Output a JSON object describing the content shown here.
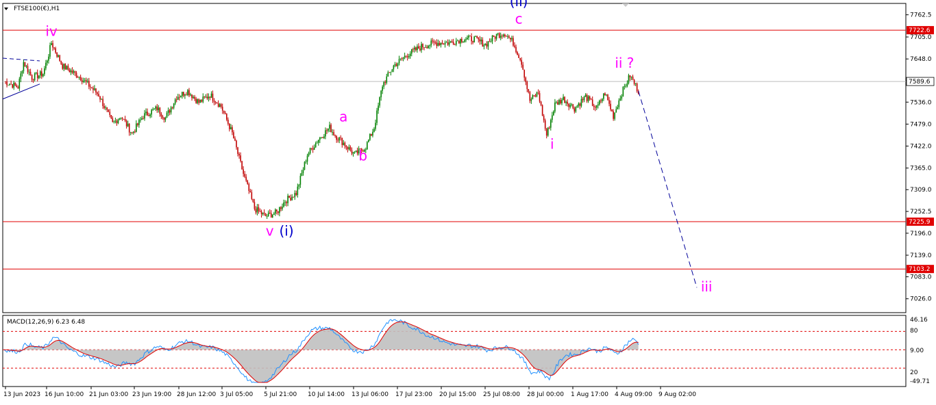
{
  "header": {
    "symbol_label": "FTSE100(€),H1",
    "dropdown_icon": "triangle-down-icon"
  },
  "colors": {
    "background": "#ffffff",
    "border": "#000000",
    "bull_candle": "#008000",
    "bear_candle": "#c00000",
    "level_line": "#e00000",
    "current_price_line": "#bcbcbc",
    "wave_pink": "#ff00ff",
    "wave_blue": "#0000cc",
    "projection_line": "#000099",
    "macd_hist": "#c0c0c0",
    "macd_main": "#1e90ff",
    "macd_signal": "#e00000",
    "macd_levels": "#e00000"
  },
  "chart_data": [
    {
      "type": "candlestick",
      "title": "FTSE100(€),H1",
      "ylim": [
        6990,
        7792
      ],
      "y_ticks": [
        7762.5,
        7705.0,
        7648.0,
        7592.5,
        7536.0,
        7479.0,
        7422.0,
        7365.0,
        7309.0,
        7252.5,
        7196.0,
        7139.0,
        7083.0,
        7026.0
      ],
      "y_tick_labels": [
        "7762.5",
        "7705.0",
        "7648.0",
        "7592.5",
        "7536.0",
        "7479.0",
        "7422.0",
        "7365.0",
        "7309.0",
        "7252.5",
        "7196.0",
        "7139.0",
        "7083.0",
        "7026.0"
      ],
      "x_tick_labels": [
        "13 Jun 2023",
        "16 Jun 10:00",
        "21 Jun 03:00",
        "23 Jun 19:00",
        "28 Jun 12:00",
        "3 Jul 05:00",
        "5 Jul 21:00",
        "10 Jul 14:00",
        "13 Jul 06:00",
        "17 Jul 23:00",
        "20 Jul 15:00",
        "25 Jul 08:00",
        "28 Jul 00:00",
        "1 Aug 17:00",
        "4 Aug 09:00",
        "9 Aug 02:00"
      ],
      "levels": [
        {
          "value": 7722.6,
          "label": "7722.6"
        },
        {
          "value": 7225.9,
          "label": "7225.9"
        },
        {
          "value": 7103.2,
          "label": "7103.2"
        }
      ],
      "current_price": {
        "value": 7589.6,
        "label": "7589.6"
      },
      "price_path": [
        [
          0,
          7590
        ],
        [
          10,
          7575
        ],
        [
          14,
          7640
        ],
        [
          20,
          7600
        ],
        [
          28,
          7610
        ],
        [
          32,
          7660
        ],
        [
          34,
          7690
        ],
        [
          42,
          7630
        ],
        [
          55,
          7600
        ],
        [
          68,
          7555
        ],
        [
          78,
          7480
        ],
        [
          84,
          7500
        ],
        [
          92,
          7455
        ],
        [
          100,
          7500
        ],
        [
          110,
          7520
        ],
        [
          116,
          7495
        ],
        [
          124,
          7550
        ],
        [
          132,
          7565
        ],
        [
          140,
          7535
        ],
        [
          148,
          7555
        ],
        [
          156,
          7525
        ],
        [
          164,
          7455
        ],
        [
          172,
          7350
        ],
        [
          180,
          7260
        ],
        [
          188,
          7240
        ],
        [
          196,
          7250
        ],
        [
          202,
          7280
        ],
        [
          210,
          7300
        ],
        [
          218,
          7400
        ],
        [
          226,
          7440
        ],
        [
          234,
          7470
        ],
        [
          238,
          7450
        ],
        [
          244,
          7430
        ],
        [
          252,
          7400
        ],
        [
          260,
          7420
        ],
        [
          266,
          7470
        ],
        [
          272,
          7580
        ],
        [
          280,
          7630
        ],
        [
          290,
          7660
        ],
        [
          300,
          7680
        ],
        [
          310,
          7690
        ],
        [
          320,
          7690
        ],
        [
          330,
          7700
        ],
        [
          338,
          7700
        ],
        [
          346,
          7685
        ],
        [
          354,
          7710
        ],
        [
          360,
          7715
        ],
        [
          366,
          7690
        ],
        [
          372,
          7640
        ],
        [
          378,
          7540
        ],
        [
          384,
          7560
        ],
        [
          390,
          7450
        ],
        [
          396,
          7530
        ],
        [
          402,
          7545
        ],
        [
          410,
          7520
        ],
        [
          418,
          7550
        ],
        [
          426,
          7520
        ],
        [
          432,
          7560
        ],
        [
          438,
          7500
        ],
        [
          444,
          7560
        ],
        [
          450,
          7605
        ],
        [
          456,
          7565
        ]
      ],
      "projection": [
        [
          456,
          7565
        ],
        [
          498,
          7055
        ]
      ],
      "wave_labels": [
        {
          "text": "iv",
          "bar": 34,
          "value": 7708,
          "color": "pink"
        },
        {
          "text": "v",
          "bar": 191,
          "value": 7190,
          "color": "pink"
        },
        {
          "text": "(i)",
          "bar": 203,
          "value": 7190,
          "color": "blue"
        },
        {
          "text": "a",
          "bar": 244,
          "value": 7486,
          "color": "pink"
        },
        {
          "text": "b",
          "bar": 258,
          "value": 7385,
          "color": "pink"
        },
        {
          "text": "(ii)",
          "bar": 370,
          "value": 7785,
          "color": "blue"
        },
        {
          "text": "c",
          "bar": 370,
          "value": 7740,
          "color": "pink"
        },
        {
          "text": "i",
          "bar": 394,
          "value": 7415,
          "color": "pink"
        },
        {
          "text": "ii ?",
          "bar": 446,
          "value": 7625,
          "color": "pink"
        },
        {
          "text": "iii",
          "bar": 505,
          "value": 7045,
          "color": "pink"
        }
      ]
    },
    {
      "type": "line",
      "title": "MACD(12,26,9) 6.23 6.48",
      "ylim": [
        -49.71,
        46.16
      ],
      "y_tick_labels": [
        "46.16",
        "80",
        "9.00",
        "20",
        "-49.71"
      ],
      "levels": [
        28,
        0,
        -28
      ],
      "series": [
        {
          "name": "MACD",
          "values": []
        },
        {
          "name": "Signal",
          "values": []
        }
      ]
    }
  ]
}
